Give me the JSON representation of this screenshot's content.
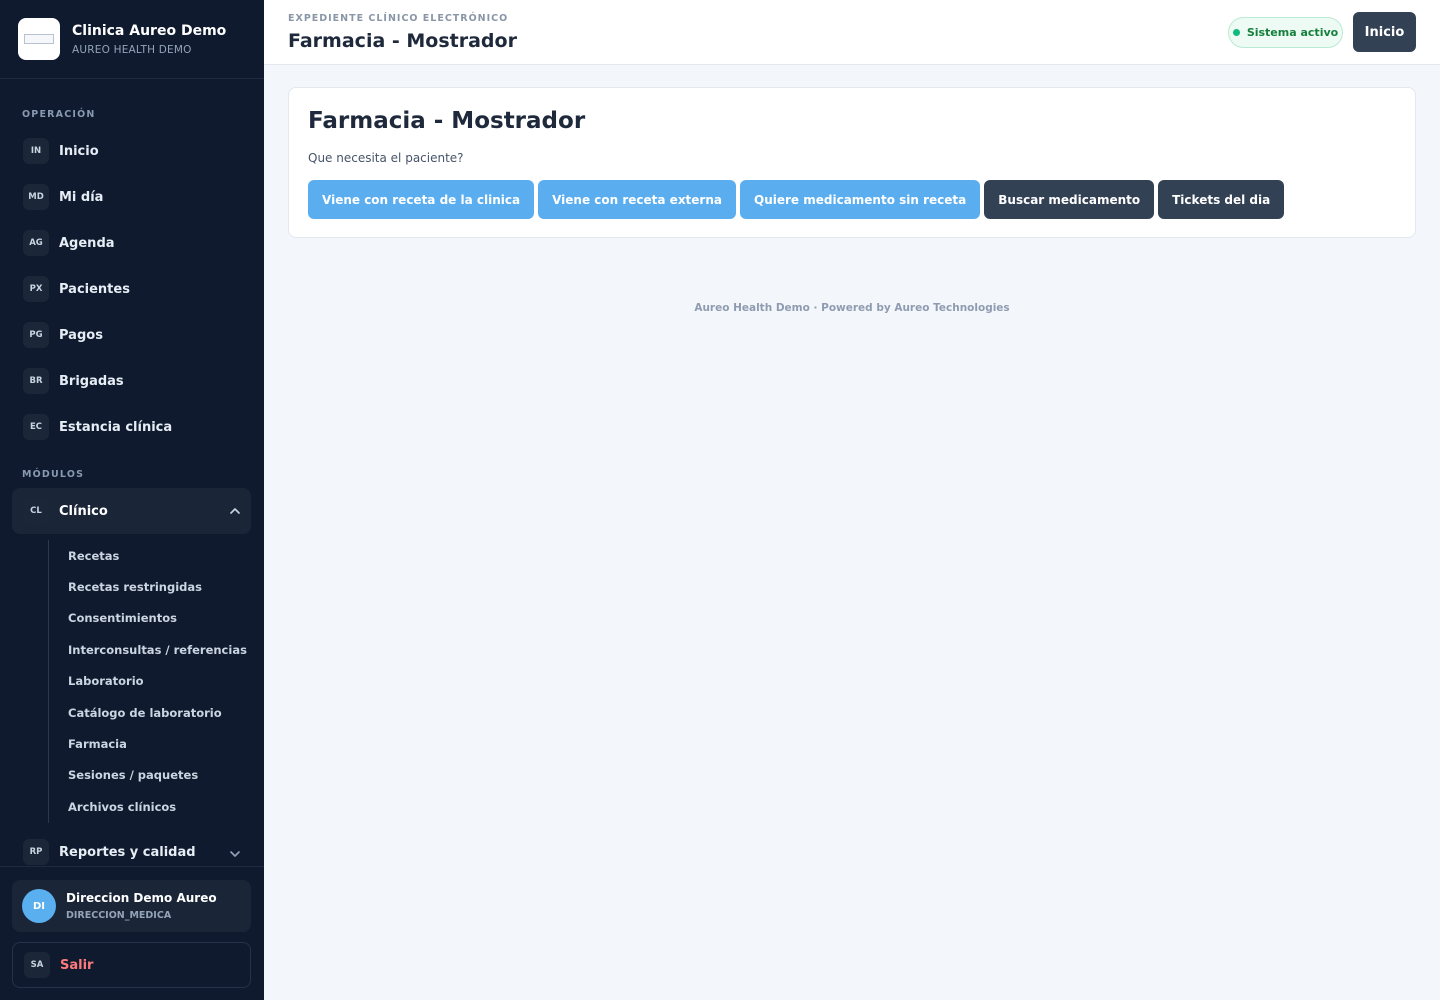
{
  "brand": {
    "name": "Clinica Aureo Demo",
    "subtitle": "AUREO HEALTH DEMO"
  },
  "sidebar": {
    "section_operation": "OPERACIÓN",
    "operation_items": [
      {
        "badge": "IN",
        "label": "Inicio"
      },
      {
        "badge": "MD",
        "label": "Mi día"
      },
      {
        "badge": "AG",
        "label": "Agenda"
      },
      {
        "badge": "PX",
        "label": "Pacientes"
      },
      {
        "badge": "PG",
        "label": "Pagos"
      },
      {
        "badge": "BR",
        "label": "Brigadas"
      },
      {
        "badge": "EC",
        "label": "Estancia clínica"
      }
    ],
    "section_modules": "MÓDULOS",
    "clinical": {
      "badge": "CL",
      "label": "Clínico"
    },
    "clinical_items": [
      "Recetas",
      "Recetas restringidas",
      "Consentimientos",
      "Interconsultas / referencias",
      "Laboratorio",
      "Catálogo de laboratorio",
      "Farmacia",
      "Sesiones / paquetes",
      "Archivos clínicos"
    ],
    "reports": {
      "badge": "RP",
      "label": "Reportes y calidad"
    }
  },
  "user": {
    "initials": "DI",
    "name": "Direccion Demo Aureo",
    "role": "DIRECCION_MEDICA"
  },
  "logout": {
    "badge": "SA",
    "label": "Salir"
  },
  "header": {
    "eyebrow": "EXPEDIENTE CLÍNICO ELECTRÓNICO",
    "title": "Farmacia - Mostrador",
    "status": "Sistema activo",
    "home_label": "Inicio"
  },
  "main": {
    "title": "Farmacia - Mostrador",
    "question": "Que necesita el paciente?",
    "actions": [
      "Viene con receta de la clinica",
      "Viene con receta externa",
      "Quiere medicamento sin receta",
      "Buscar medicamento",
      "Tickets del dia"
    ]
  },
  "footer": "Aureo Health Demo · Powered by Aureo Technologies",
  "colors": {
    "sidebar_bg": "#0f1a2e",
    "accent_blue": "#5aaef0",
    "dark_button": "#334155",
    "status_green": "#10b981",
    "logout_red": "#ff7b7b"
  }
}
